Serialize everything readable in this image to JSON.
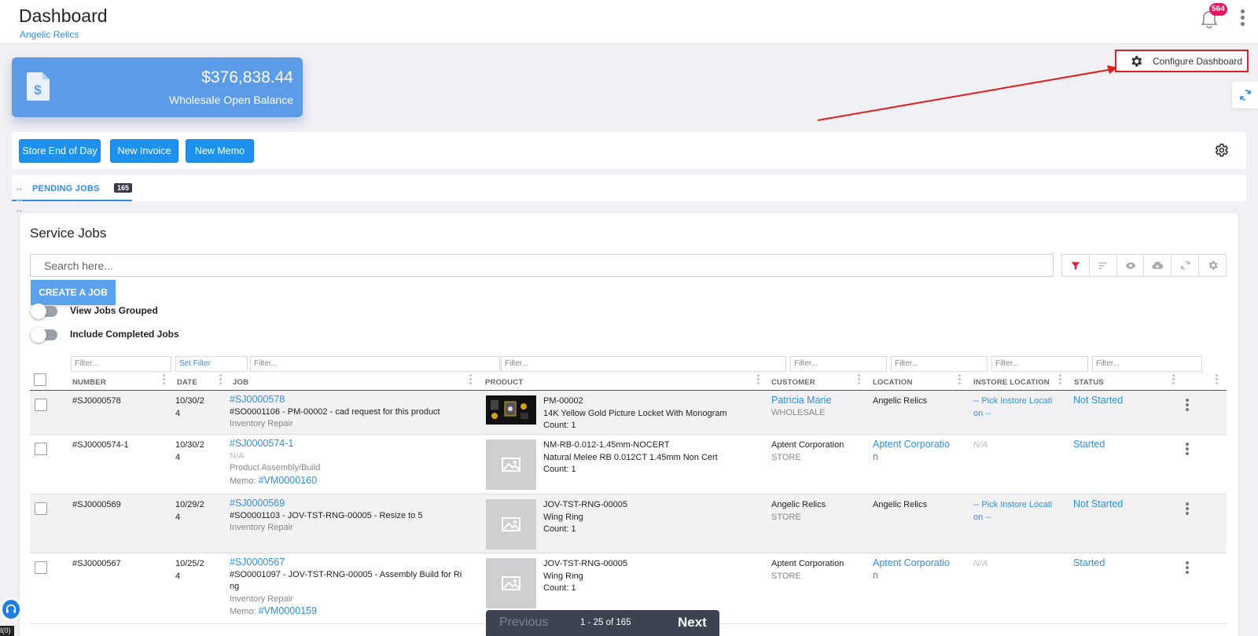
{
  "header": {
    "title": "Dashboard",
    "subtitle": "Angelic Relics",
    "notification_count": "564"
  },
  "balance_card": {
    "amount": "$376,838.44",
    "label": "Wholesale Open Balance",
    "accent": "#5b9be8"
  },
  "configure": {
    "label": "Configure Dashboard"
  },
  "actions": {
    "store_end_of_day": "Store End of Day",
    "new_invoice": "New Invoice",
    "new_memo": "New Memo"
  },
  "tabs": [
    {
      "label": "PENDING JOBS",
      "count": "165"
    }
  ],
  "service_jobs": {
    "title": "Service Jobs",
    "search_placeholder": "Search here...",
    "create_label": "CREATE A JOB",
    "toggles": {
      "grouped": "View Jobs Grouped",
      "completed": "Include Completed Jobs"
    },
    "filters": {
      "placeholder": "Filter...",
      "set_filter": "Set Filter"
    },
    "columns": {
      "number": "NUMBER",
      "date": "DATE",
      "job": "JOB",
      "product": "PRODUCT",
      "customer": "CUSTOMER",
      "location": "LOCATION",
      "instore_location": "INSTORE LOCATION",
      "status": "STATUS"
    },
    "rows": [
      {
        "number": "#SJ0000578",
        "date_1": "10/30/2",
        "date_2": "4",
        "job_link": "#SJ0000578",
        "job_line2": "#SO0001106 - PM-00002 - cad request for this product",
        "job_line3": "Inventory Repair",
        "product_sku": "PM-00002",
        "product_name": "14K Yellow Gold Picture Locket With Monogram",
        "product_count": "Count: 1",
        "customer": "Patricia Marie",
        "customer_type": "WHOLESALE",
        "location": "Angelic Relics",
        "instore_1": "-- Pick Instore Locati",
        "instore_2": "on --",
        "status": "Not Started"
      },
      {
        "number": "#SJ0000574-1",
        "date_1": "10/30/2",
        "date_2": "4",
        "job_link": "#SJ0000574-1",
        "job_line2": "N/A",
        "job_line3": "Product Assembly/Build",
        "memo_label": "Memo:",
        "memo_link": "#VM0000160",
        "product_sku": "NM-RB-0.012-1.45mm-NOCERT",
        "product_name": "Natural Melee RB 0.012CT 1.45mm Non Cert",
        "product_count": "Count: 1",
        "customer": "Aptent Corporation",
        "customer_type": "STORE",
        "location_1": "Aptent Corporatio",
        "location_2": "n",
        "instore": "N/A",
        "status": "Started"
      },
      {
        "number": "#SJ0000569",
        "date_1": "10/29/2",
        "date_2": "4",
        "job_link": "#SJ0000569",
        "job_line2": "#SO0001103 - JOV-TST-RNG-00005 - Resize to 5",
        "job_line3": "Inventory Repair",
        "product_sku": "JOV-TST-RNG-00005",
        "product_name": "Wing Ring",
        "product_count": "Count: 1",
        "customer": "Angelic Relics",
        "customer_type": "STORE",
        "location": "Angelic Relics",
        "instore_1": "-- Pick Instore Locati",
        "instore_2": "on --",
        "status": "Not Started"
      },
      {
        "number": "#SJ0000567",
        "date_1": "10/25/2",
        "date_2": "4",
        "job_link": "#SJ0000567",
        "job_line2": "#SO0001097 - JOV-TST-RNG-00005 - Assembly Build for Ri",
        "job_line2b": "ng",
        "job_line3": "Inventory Repair",
        "memo_label": "Memo:",
        "memo_link": "#VM0000159",
        "product_sku": "JOV-TST-RNG-00005",
        "product_name": "Wing Ring",
        "product_count": "Count: 1",
        "customer": "Aptent Corporation",
        "customer_type": "STORE",
        "location_1": "Aptent Corporatio",
        "location_2": "n",
        "instore": "N/A",
        "status": "Started"
      }
    ]
  },
  "pagination": {
    "previous": "Previous",
    "range": "1 - 25 of 165",
    "next": "Next"
  },
  "bottom_tag": "I(0)"
}
